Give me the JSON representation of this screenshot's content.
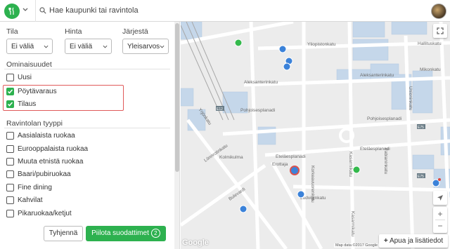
{
  "search": {
    "placeholder": "Hae kaupunki tai ravintola"
  },
  "filters": {
    "price_label": "Tila",
    "price_value": "Ei väliä",
    "cost_label": "Hinta",
    "cost_value": "Ei väliä",
    "sort_label": "Järjestä",
    "sort_value": "Yleisarvos"
  },
  "features": {
    "title": "Ominaisuudet",
    "items": [
      {
        "label": "Uusi",
        "checked": false
      },
      {
        "label": "Pöytävaraus",
        "checked": true
      },
      {
        "label": "Tilaus",
        "checked": true
      }
    ]
  },
  "types": {
    "title": "Ravintolan tyyppi",
    "items": [
      {
        "label": "Aasialaista ruokaa"
      },
      {
        "label": "Eurooppalaista ruokaa"
      },
      {
        "label": "Muuta etnistä ruokaa"
      },
      {
        "label": "Baari/pubiruokaa"
      },
      {
        "label": "Fine dining"
      },
      {
        "label": "Kahvilat"
      },
      {
        "label": "Pikaruokaa/ketjut"
      }
    ]
  },
  "footer": {
    "clear_label": "Tyhjennä",
    "hide_label": "Piilota suodattimet",
    "count": "2"
  },
  "map": {
    "streets": [
      "Yliopistonkatu",
      "Hallituskatu",
      "Mikonkatu",
      "Aleksanterinkatu",
      "Aleksanterinkatu",
      "Pohjoisesplanadi",
      "Pohjoisesplanadi",
      "Eteläesplanadi",
      "Eteläesplanadi",
      "Yrjönkatu",
      "Lönnrotinkatu",
      "Bulevardi",
      "Erottaja",
      "Kolmikulma",
      "Ludviginkatu",
      "Korkeavuorenkatu",
      "Kasarmikatu",
      "Fabianinkatu",
      "Unioninkatu",
      "Kasarmikatu",
      "E12",
      "E75",
      "E75"
    ],
    "help_label": "Apua ja lisätiedot",
    "google_label": "Google",
    "attribution": "Map data ©2017 Google"
  }
}
